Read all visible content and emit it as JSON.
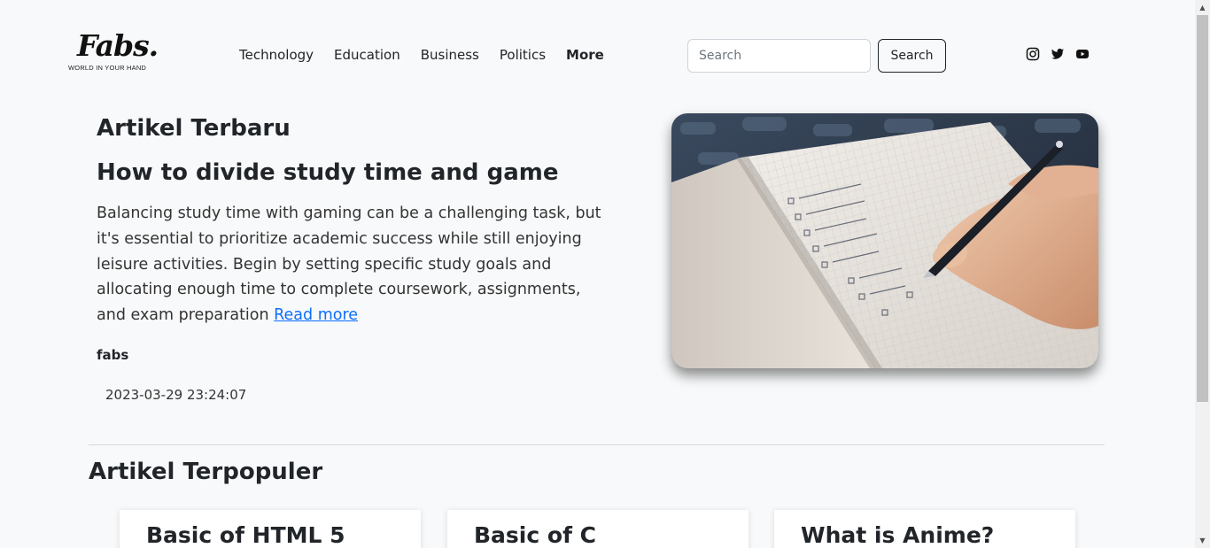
{
  "brand": {
    "name": "Fabs.",
    "tagline": "WORLD IN YOUR HAND"
  },
  "nav": {
    "items": [
      {
        "label": "Technology"
      },
      {
        "label": "Education"
      },
      {
        "label": "Business"
      },
      {
        "label": "Politics"
      },
      {
        "label": "More"
      }
    ]
  },
  "search": {
    "placeholder": "Search",
    "button_label": "Search"
  },
  "social": {
    "icons": [
      "instagram-icon",
      "twitter-icon",
      "youtube-icon"
    ]
  },
  "latest": {
    "section_title": "Artikel Terbaru",
    "article_title": "How to divide study time and game",
    "excerpt": "Balancing study time with gaming can be a challenging task, but it's essential to prioritize academic success while still enjoying leisure activities. Begin by setting specific study goals and allocating enough time to complete coursework, assignments, and exam preparation ",
    "read_more": "Read more",
    "author": "fabs",
    "date": "2023-03-29 23:24:07"
  },
  "popular": {
    "section_title": "Artikel Terpopuler",
    "cards": [
      {
        "title": "Basic of HTML 5"
      },
      {
        "title": "Basic of C"
      },
      {
        "title": "What is Anime?"
      }
    ]
  },
  "colors": {
    "background": "#f8f9fa",
    "text": "#212529",
    "link": "#0d6efd"
  }
}
